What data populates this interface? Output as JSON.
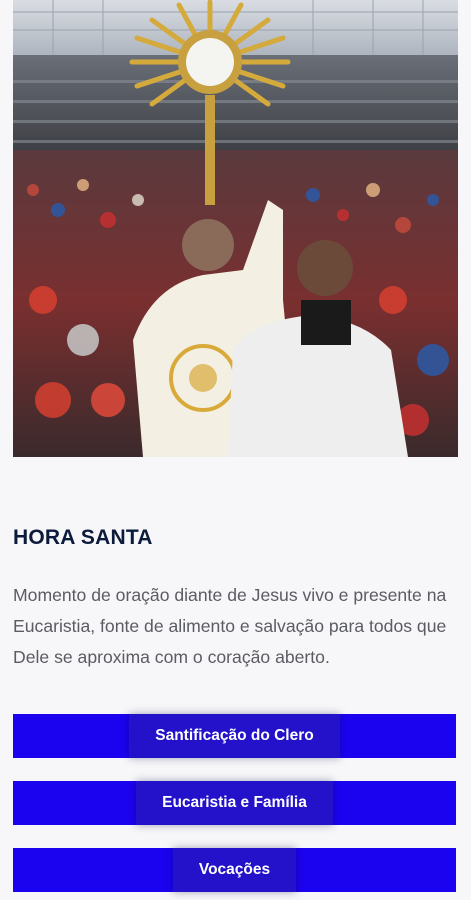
{
  "hero": {
    "image_name": "monstrance-adoration-photo"
  },
  "section": {
    "title": "HORA SANTA",
    "description": "Momento de oração diante de Jesus vivo e presente na Eucaristia, fonte de alimento e salvação para todos que Dele se aproxima com o coração aberto."
  },
  "buttons": [
    {
      "label": "Santificação do Clero"
    },
    {
      "label": "Eucaristia e Família"
    },
    {
      "label": "Vocações"
    }
  ],
  "colors": {
    "button": "#1c03f0",
    "button_label_bg": "#2312c9",
    "title": "#0c1a3c",
    "text": "#5b5b63"
  }
}
